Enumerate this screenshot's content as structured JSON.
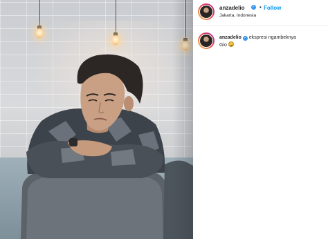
{
  "post": {
    "image": {
      "alt": "Photo post"
    },
    "header": {
      "username": "anzadelio",
      "separator": "•",
      "follow_label": "Follow",
      "location": "Jakarta, Indonesia"
    },
    "caption": {
      "username": "anzadelio",
      "text_line1": "ekspresi ngambeknya",
      "text_line2": "Gio",
      "emoji": "pouting-face-emoji"
    },
    "colors": {
      "accent": "#0095f6",
      "verified": "#3897f0",
      "text": "#262626"
    }
  }
}
